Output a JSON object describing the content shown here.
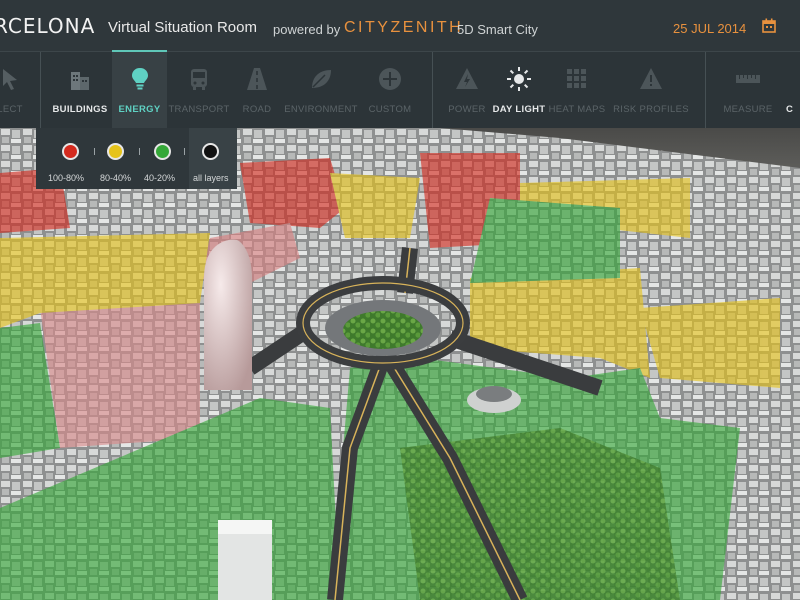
{
  "header": {
    "city_title": "RCELONA",
    "room_title": "Virtual Situation Room",
    "powered_by": "powered by",
    "brand": "CITYZENITH",
    "brand_suffix": "5D Smart City",
    "date": "25 JUL 2014",
    "calendar_icon": "calendar-icon",
    "accent_color": "#e8913e"
  },
  "toolbar": {
    "items": [
      {
        "label": "LECT",
        "icon": "cursor-icon",
        "state": "dim"
      },
      {
        "label": "BUILDINGS",
        "icon": "buildings-icon",
        "state": "bright"
      },
      {
        "label": "ENERGY",
        "icon": "lightbulb-icon",
        "state": "active"
      },
      {
        "label": "TRANSPORT",
        "icon": "bus-icon",
        "state": "dim"
      },
      {
        "label": "ROAD",
        "icon": "road-icon",
        "state": "dim"
      },
      {
        "label": "ENVIRONMENT",
        "icon": "leaf-icon",
        "state": "dim"
      },
      {
        "label": "CUSTOM",
        "icon": "plus-icon",
        "state": "dim"
      },
      {
        "label": "POWER",
        "icon": "bolt-icon",
        "state": "dim"
      },
      {
        "label": "DAY LIGHT",
        "icon": "sun-icon",
        "state": "bright"
      },
      {
        "label": "HEAT MAPS",
        "icon": "grid-icon",
        "state": "dim"
      },
      {
        "label": "RISK PROFILES",
        "icon": "warning-icon",
        "state": "dim"
      },
      {
        "label": "MEASURE",
        "icon": "ruler-icon",
        "state": "dim"
      },
      {
        "label": "C",
        "icon": "",
        "state": "bright"
      }
    ],
    "active_color": "#5fd1c3"
  },
  "legend": {
    "items": [
      {
        "label": "100-80%",
        "color": "#d42a1e"
      },
      {
        "label": "80-40%",
        "color": "#e6c31a"
      },
      {
        "label": "40-20%",
        "color": "#35a838"
      },
      {
        "label": "all layers",
        "color": "#111111"
      }
    ]
  }
}
